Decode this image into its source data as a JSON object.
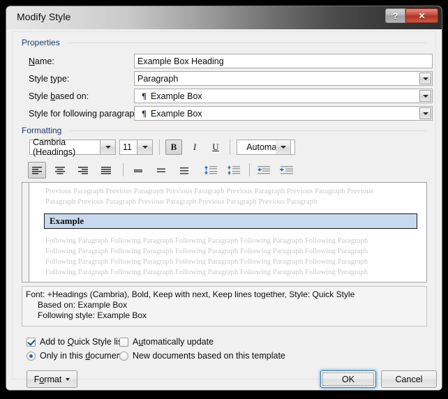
{
  "window": {
    "title": "Modify Style",
    "help_button": "?",
    "close_button": "✕"
  },
  "properties": {
    "group_label": "Properties",
    "name_label": "Name:",
    "name_value": "Example Box Heading",
    "style_type_label": "Style type:",
    "style_type_value": "Paragraph",
    "style_based_on_label": "Style based on:",
    "style_based_on_value": "Example Box",
    "style_following_label": "Style for following paragraph:",
    "style_following_value": "Example Box",
    "pilcrow": "¶"
  },
  "formatting": {
    "group_label": "Formatting",
    "font_family": "Cambria (Headings)",
    "font_size": "11",
    "bold": "B",
    "italic": "I",
    "underline": "U",
    "font_color": "Automatic",
    "align_left_icon": "align-left-icon",
    "align_center_icon": "align-center-icon",
    "align_right_icon": "align-right-icon",
    "align_justify_icon": "align-justify-icon",
    "line_spacing_single_icon": "line-spacing-single-icon",
    "line_spacing_15_icon": "line-spacing-1-5-icon",
    "line_spacing_double_icon": "line-spacing-double-icon",
    "space_before_icon": "space-before-paragraph-icon",
    "space_after_icon": "space-after-paragraph-icon",
    "decrease_indent_icon": "decrease-indent-icon",
    "increase_indent_icon": "increase-indent-icon"
  },
  "preview": {
    "previous_line_1": "Previous Paragraph Previous Paragraph Previous Paragraph Previous Paragraph Previous Paragraph Previous",
    "previous_line_2": "Paragraph Previous Paragraph Previous Paragraph Previous Paragraph Previous Paragraph",
    "example_text": "Example",
    "following_line_1": "Following Paragraph Following Paragraph Following Paragraph Following Paragraph Following Paragraph",
    "following_line_2": "Following Paragraph Following Paragraph Following Paragraph Following Paragraph Following Paragraph",
    "following_line_3": "Following Paragraph Following Paragraph Following Paragraph Following Paragraph Following Paragraph",
    "following_line_4": "Following Paragraph Following Paragraph Following Paragraph Following Paragraph Following Paragraph",
    "example_box_fill": "#c9d9ee",
    "example_box_border": "#1a1a1a"
  },
  "description": {
    "line_1": "Font: +Headings (Cambria), Bold, Keep with next, Keep lines together, Style: Quick Style",
    "line_2": "Based on: Example Box",
    "line_3": "Following style: Example Box"
  },
  "options": {
    "add_to_quick_style_label": "Add to Quick Style list",
    "add_to_quick_style_checked": true,
    "automatically_update_label": "Automatically update",
    "automatically_update_checked": false,
    "only_this_document_label": "Only in this document",
    "only_this_document_selected": true,
    "new_documents_label": "New documents based on this template",
    "new_documents_selected": false
  },
  "footer": {
    "format_button": "Format",
    "ok_button": "OK",
    "cancel_button": "Cancel"
  }
}
